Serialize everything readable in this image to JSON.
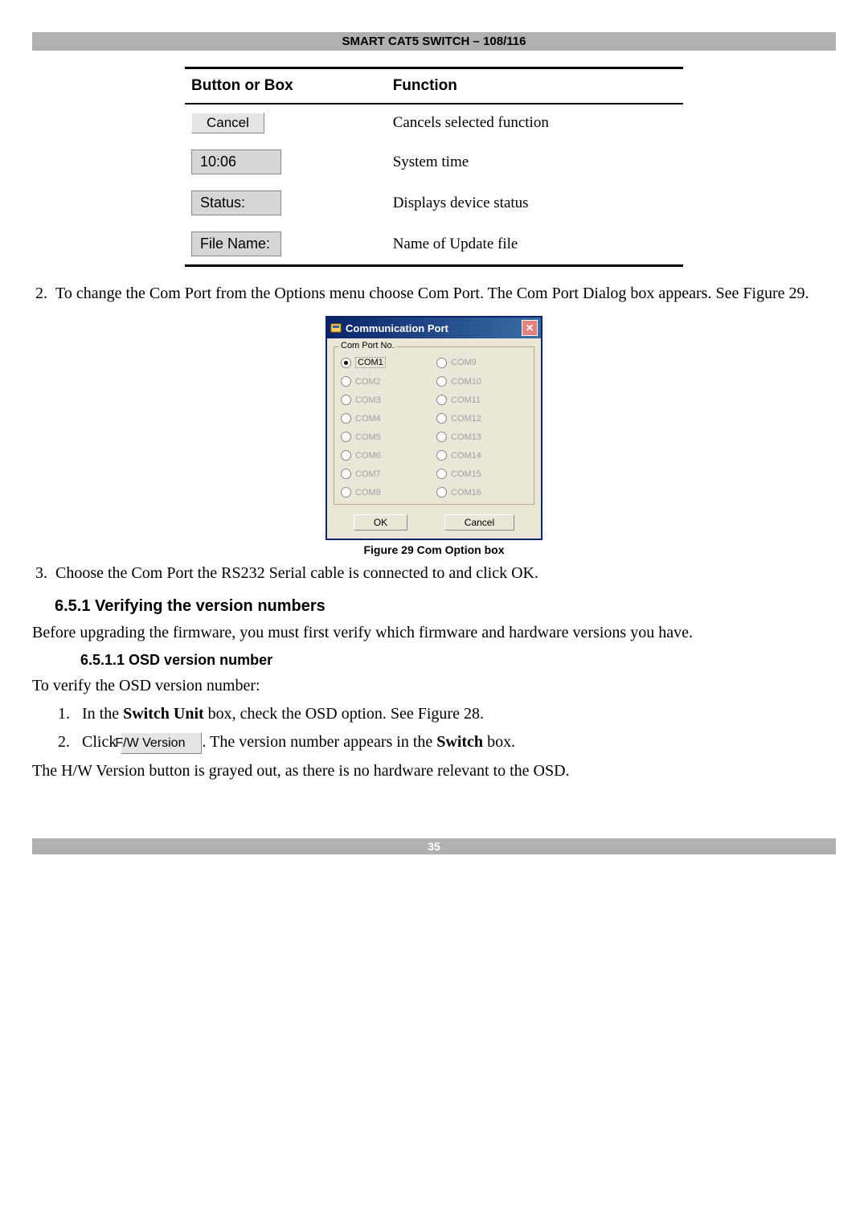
{
  "header": "SMART CAT5 SWITCH – 108/116",
  "table": {
    "col1": "Button or Box",
    "col2": "Function",
    "rows": [
      {
        "label": "Cancel",
        "is_button": true,
        "desc": "Cancels selected function"
      },
      {
        "label": "10:06",
        "is_button": false,
        "desc": "System time"
      },
      {
        "label": "Status:",
        "is_button": false,
        "desc": "Displays device status"
      },
      {
        "label": "File Name:",
        "is_button": false,
        "desc": "Name of Update file"
      }
    ]
  },
  "step2_num": "2.",
  "step2_text": "To change the Com Port from the Options menu choose Com Port. The Com Port Dialog box appears. See Figure 29.",
  "dialog": {
    "title": "Communication Port",
    "group_label": "Com Port No.",
    "options_left": [
      "COM1",
      "COM2",
      "COM3",
      "COM4",
      "COM5",
      "COM6",
      "COM7",
      "COM8"
    ],
    "options_right": [
      "COM9",
      "COM10",
      "COM11",
      "COM12",
      "COM13",
      "COM14",
      "COM15",
      "COM16"
    ],
    "selected": "COM1",
    "ok": "OK",
    "cancel": "Cancel"
  },
  "fig_caption": "Figure 29 Com Option box",
  "step3_num": "3.",
  "step3_text": "Choose the Com Port the RS232 Serial cable is connected to and click OK.",
  "section_651": "6.5.1 Verifying the version numbers",
  "section_651_body": "Before upgrading the firmware, you must first verify which firmware and hardware versions you have.",
  "section_6511": "6.5.1.1 OSD version number",
  "section_6511_intro": "To verify the OSD version number:",
  "osd_step1_num": "1.",
  "osd_step1_a": "In the ",
  "osd_step1_bold": "Switch Unit",
  "osd_step1_b": " box, check the OSD option. See Figure 28.",
  "osd_step2_num": "2.",
  "osd_step2_a": "Click ",
  "osd_step2_btn": "F/W Version",
  "osd_step2_b": ". The version number appears in the ",
  "osd_step2_bold": "Switch",
  "osd_step2_c": " box.",
  "hw_note": "The H/W Version button is grayed out, as there is no hardware relevant to the OSD.",
  "footer": "35"
}
